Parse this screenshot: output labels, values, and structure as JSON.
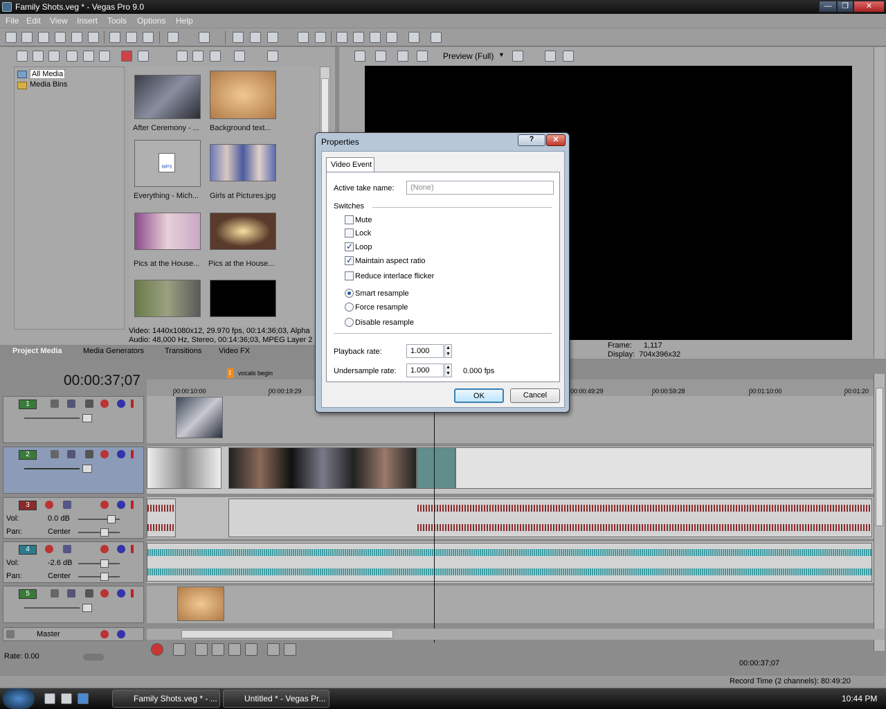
{
  "window": {
    "title": "Family Shots.veg * - Vegas Pro 9.0"
  },
  "menu": [
    "File",
    "Edit",
    "View",
    "Insert",
    "Tools",
    "Options",
    "Help"
  ],
  "explorer": {
    "tree": [
      "All Media",
      "Media Bins"
    ]
  },
  "media": [
    {
      "label": "After Ceremony - ...",
      "color": "#4a4f5c"
    },
    {
      "label": "Background text...",
      "color": "#c89a6a"
    },
    {
      "label": "Everything - Mich...",
      "color": "#b5b5b5",
      "badge": "MP3"
    },
    {
      "label": "Girls at Pictures.jpg",
      "color": "#5a6aa0"
    },
    {
      "label": "Pics at the House...",
      "color": "#9b6aa8"
    },
    {
      "label": "Pics at the House...",
      "color": "#6a4a3a"
    },
    {
      "label": "",
      "color": "#6f7a5a"
    },
    {
      "label": "",
      "color": "#000000"
    }
  ],
  "media_info": {
    "video": "Video: 1440x1080x12, 29.970 fps, 00:14:36;03, Alpha",
    "audio": "Audio: 48,000 Hz, Stereo, 00:14:36;03, MPEG Layer 2"
  },
  "left_tabs": [
    "Project Media",
    "Media Generators",
    "Transitions",
    "Video FX"
  ],
  "preview": {
    "mode": "Preview (Full)",
    "frame_label": "Frame:",
    "frame_value": "1,117",
    "display_label": "Display:",
    "display_value": "704x396x32"
  },
  "timeline": {
    "timecode": "00:00:37;07",
    "marker": "vocals begin",
    "marker_num": "1",
    "ruler": [
      "00:00:10:00",
      "00:00:19:29",
      "00:00:49:29",
      "00:00:59:28",
      "00:01:10:00",
      "00:01:20"
    ],
    "tracks": [
      {
        "num": "1",
        "kind": "video"
      },
      {
        "num": "2",
        "kind": "video",
        "selected": true
      },
      {
        "num": "3",
        "kind": "audio",
        "vol_label": "Vol:",
        "vol": "0.0 dB",
        "pan_label": "Pan:",
        "pan": "Center"
      },
      {
        "num": "4",
        "kind": "audio",
        "vol_label": "Vol:",
        "vol": "-2.6 dB",
        "pan_label": "Pan:",
        "pan": "Center"
      },
      {
        "num": "5",
        "kind": "video"
      }
    ],
    "master": "Master",
    "rate": "Rate: 0.00",
    "tc_box": "00:00:37;07"
  },
  "status": {
    "record": "Record Time (2 channels): 80:49:20"
  },
  "taskbar": {
    "items": [
      "Family Shots.veg * - ...",
      "Untitled * - Vegas Pr..."
    ],
    "clock": "10:44 PM"
  },
  "dialog": {
    "title": "Properties",
    "help": "?",
    "close": "✕",
    "tab": "Video Event",
    "active_take_label": "Active take name:",
    "active_take_value": "(None)",
    "switches_label": "Switches",
    "switches": [
      {
        "label": "Mute",
        "checked": false
      },
      {
        "label": "Lock",
        "checked": false
      },
      {
        "label": "Loop",
        "checked": true
      },
      {
        "label": "Maintain aspect ratio",
        "checked": true
      },
      {
        "label": "Reduce interlace flicker",
        "checked": false
      }
    ],
    "resample": [
      {
        "label": "Smart resample",
        "selected": true
      },
      {
        "label": "Force resample",
        "selected": false
      },
      {
        "label": "Disable resample",
        "selected": false
      }
    ],
    "playback_label": "Playback rate:",
    "playback_value": "1.000",
    "undersample_label": "Undersample rate:",
    "undersample_value": "1.000",
    "fps": "0.000 fps",
    "ok": "OK",
    "cancel": "Cancel"
  }
}
